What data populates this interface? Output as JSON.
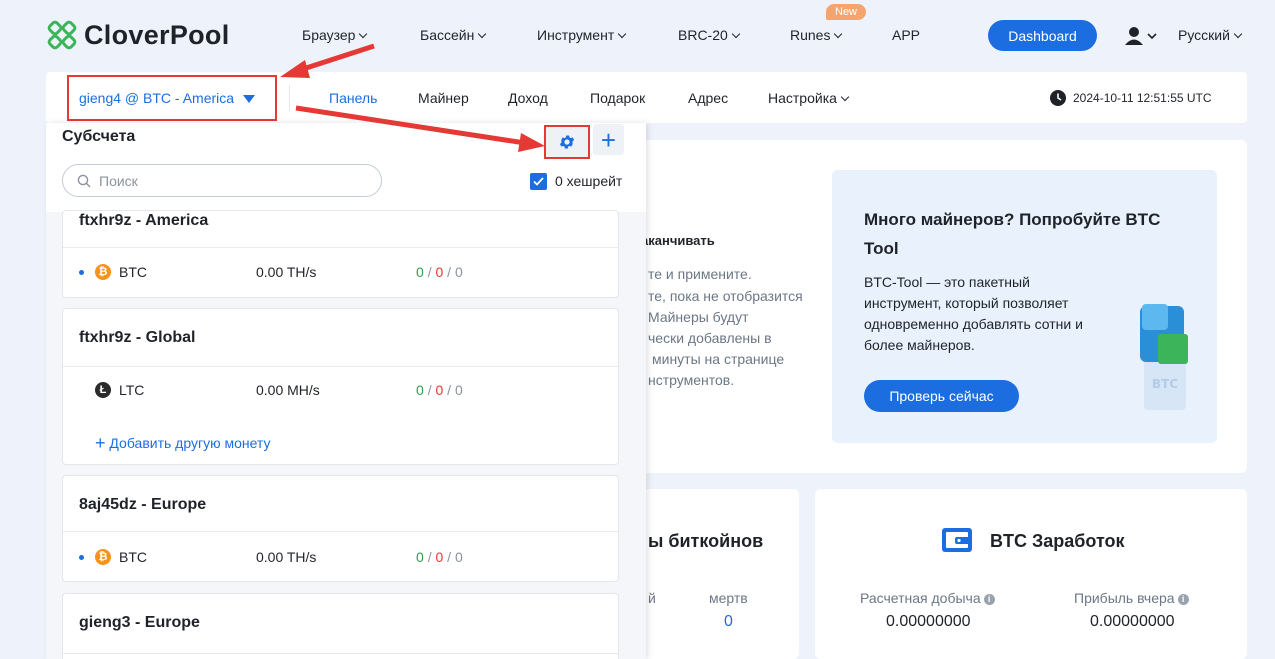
{
  "header": {
    "logo_text": "CloverPool",
    "nav": [
      {
        "label": "Браузер"
      },
      {
        "label": "Бассейн"
      },
      {
        "label": "Инструмент"
      },
      {
        "label": "BRC-20"
      },
      {
        "label": "Runes"
      },
      {
        "label": "APP"
      }
    ],
    "new_badge": "New",
    "dashboard_label": "Dashboard",
    "language": "Русский"
  },
  "subbar": {
    "account": "gieng4 @ BTC - America",
    "tabs": [
      {
        "label": "Панель"
      },
      {
        "label": "Майнер"
      },
      {
        "label": "Доход"
      },
      {
        "label": "Подарок"
      },
      {
        "label": "Адрес"
      },
      {
        "label": "Настройка"
      }
    ],
    "datetime": "2024-10-11 12:51:55 UTC"
  },
  "dropdown": {
    "title": "Субсчета",
    "search_placeholder": "Поиск",
    "zero_hashrate_label": "0 хешрейт",
    "add_coin_label": "Добавить другую монету",
    "accounts": [
      {
        "name": "ftxhr9z - America",
        "coin": "BTC",
        "rate": "0.00 TH/s",
        "c1": "0",
        "c2": "0",
        "c3": "0"
      },
      {
        "name": "ftxhr9z - Global",
        "coin": "LTC",
        "rate": "0.00 MH/s",
        "c1": "0",
        "c2": "0",
        "c3": "0"
      },
      {
        "name": "8aj45dz - Europe",
        "coin": "BTC",
        "rate": "0.00 TH/s",
        "c1": "0",
        "c2": "0",
        "c3": "0"
      },
      {
        "name": "gieng3 - Europe"
      }
    ]
  },
  "background": {
    "partial_lines": [
      "аканчивать",
      "те и примените.",
      "те, пока не отобразится",
      "Майнеры будут",
      "чески добавлены в",
      "минуты на странице",
      "нструментов."
    ],
    "promo": {
      "title": "Много майнеров? Попробуйте BTC Tool",
      "desc": "BTC-Tool — это пакетный инструмент, который позволяет одновременно добавлять сотни и более майнеров.",
      "button": "Проверь сейчас"
    },
    "card_a": {
      "title_partial": "ы биткойнов",
      "col1": "й",
      "col2": "мертв",
      "value": "0"
    },
    "card_b": {
      "title": "BTC Заработок",
      "est_label": "Расчетная добыча",
      "est_value": "0.00000000",
      "yday_label": "Прибыль вчера",
      "yday_value": "0.00000000"
    }
  },
  "colors": {
    "accent": "#1c6ee0",
    "highlight": "#e53935",
    "btc": "#f7931a",
    "ltc": "#2b2b2b"
  }
}
